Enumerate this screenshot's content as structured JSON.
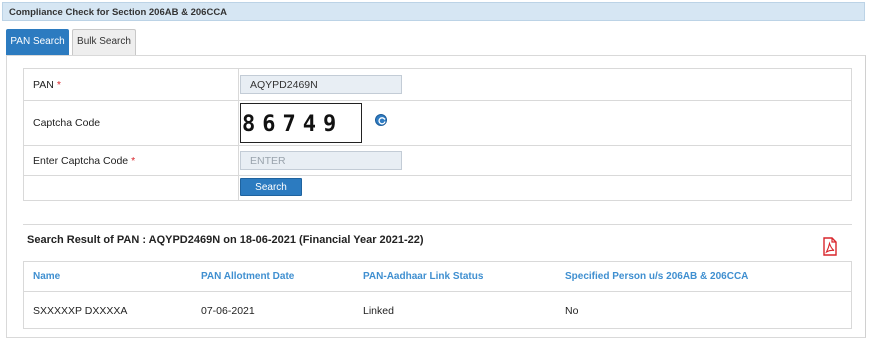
{
  "page_title": "Compliance Check for Section 206AB & 206CCA",
  "tabs": [
    {
      "label": "PAN Search",
      "active": true
    },
    {
      "label": "Bulk Search",
      "active": false
    }
  ],
  "form": {
    "pan_label": "PAN",
    "pan_required": "*",
    "pan_value": "AQYPD2469N",
    "captcha_label": "Captcha Code",
    "captcha_text": "86749",
    "enter_captcha_label": "Enter Captcha Code",
    "enter_captcha_required": "*",
    "enter_captcha_placeholder": "ENTER",
    "search_button": "Search"
  },
  "result": {
    "title": "Search Result of PAN : AQYPD2469N on 18-06-2021 (Financial Year 2021-22)",
    "columns": [
      "Name",
      "PAN Allotment Date",
      "PAN-Aadhaar Link Status",
      "Specified Person u/s 206AB & 206CCA"
    ],
    "rows": [
      [
        "SXXXXXP DXXXXA",
        "07-06-2021",
        "Linked",
        "No"
      ]
    ]
  },
  "colors": {
    "accent": "#2c7bc0",
    "header_text": "#3f8fd0",
    "required": "#d9262c",
    "title_bar": "#d6e6f3"
  },
  "icons": [
    "refresh-icon",
    "pdf-icon"
  ]
}
